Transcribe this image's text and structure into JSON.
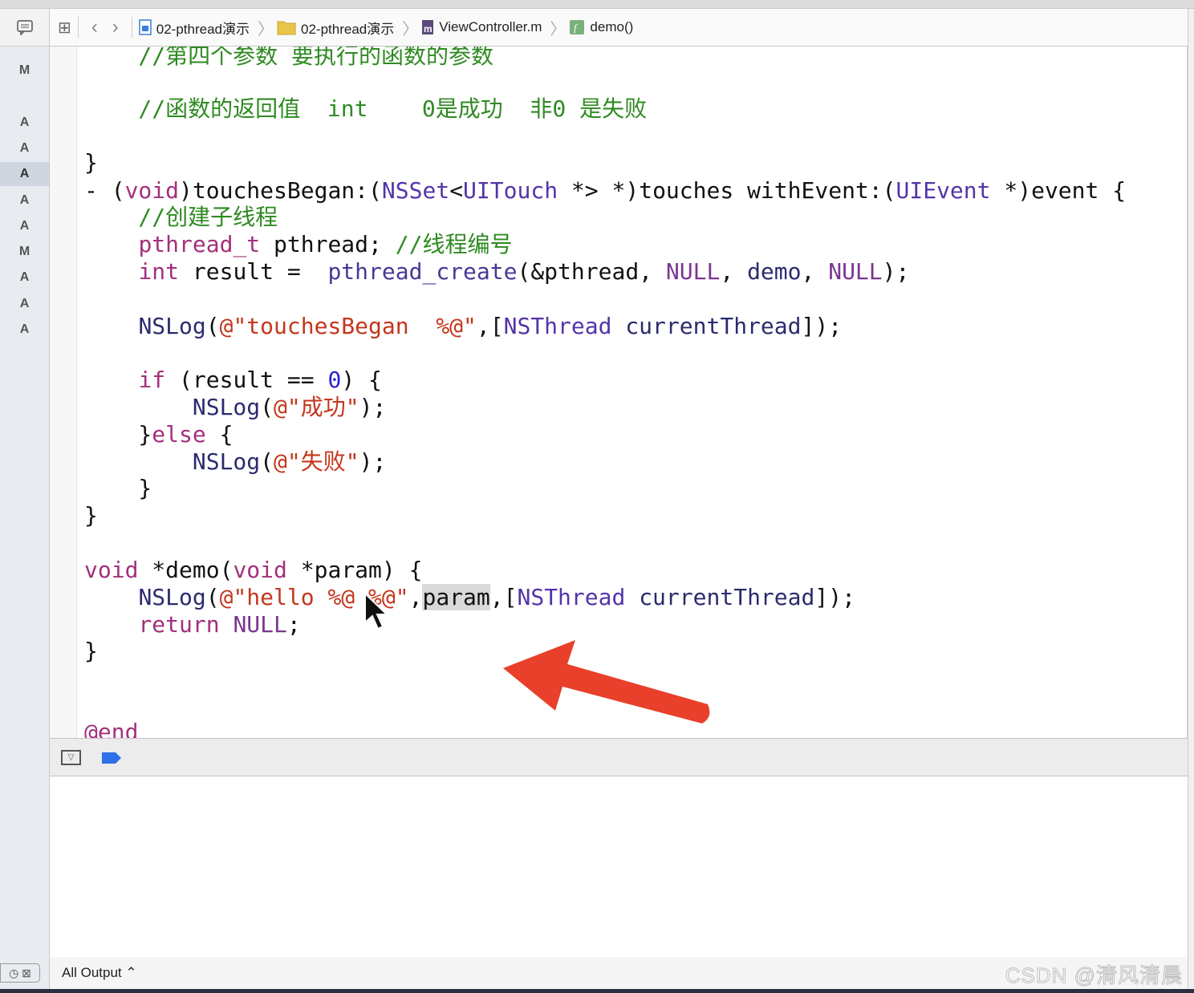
{
  "breadcrumb": [
    {
      "label": "02-pthread演示",
      "icon": "project-file-icon"
    },
    {
      "label": "02-pthread演示",
      "icon": "folder-icon"
    },
    {
      "label": "ViewController.m",
      "icon": "m-file-icon"
    },
    {
      "label": "demo()",
      "icon": "function-icon"
    }
  ],
  "sidebar": {
    "letters": [
      "M",
      "A",
      "A",
      "A",
      "A",
      "A",
      "M",
      "A",
      "A",
      "A"
    ],
    "selected_index": 4
  },
  "code": [
    [
      [
        "    //第四个参数 要执行的函数的参数",
        "cm"
      ]
    ],
    [
      [
        "    //函数的返回值  int    0是成功  非0 是失败",
        "cm"
      ]
    ],
    [
      [
        "}",
        ""
      ]
    ],
    [
      [
        "- (",
        ""
      ],
      [
        "void",
        "kw"
      ],
      [
        ")touchesBegan:(",
        ""
      ],
      [
        "NSSet",
        "ty"
      ],
      [
        "<",
        ""
      ],
      [
        "UITouch",
        "ty"
      ],
      [
        " *> *)touches withEvent:(",
        ""
      ],
      [
        "UIEvent",
        "ty"
      ],
      [
        " *)event {",
        ""
      ]
    ],
    [
      [
        "    //创建子线程",
        "cm"
      ]
    ],
    [
      [
        "    ",
        ""
      ],
      [
        "pthread_t",
        "kw"
      ],
      [
        " pthread; ",
        ""
      ],
      [
        "//线程编号",
        "cm"
      ]
    ],
    [
      [
        "    ",
        ""
      ],
      [
        "int",
        "kw"
      ],
      [
        " result =  ",
        ""
      ],
      [
        "pthread_create",
        "fn"
      ],
      [
        "(&pthread, ",
        ""
      ],
      [
        "NULL",
        "mc"
      ],
      [
        ", ",
        ""
      ],
      [
        "demo",
        "lg"
      ],
      [
        ", ",
        ""
      ],
      [
        "NULL",
        "mc"
      ],
      [
        ");",
        ""
      ]
    ],
    [
      [
        "",
        ""
      ]
    ],
    [
      [
        "    ",
        ""
      ],
      [
        "NSLog",
        "lg"
      ],
      [
        "(",
        ""
      ],
      [
        "@\"touchesBegan  %@\"",
        "st"
      ],
      [
        ",[",
        ""
      ],
      [
        "NSThread",
        "ty"
      ],
      [
        " ",
        ""
      ],
      [
        "currentThread",
        "lg"
      ],
      [
        "]);",
        ""
      ]
    ],
    [
      [
        "",
        ""
      ]
    ],
    [
      [
        "    ",
        ""
      ],
      [
        "if",
        "kw"
      ],
      [
        " (result == ",
        ""
      ],
      [
        "0",
        "nu"
      ],
      [
        ") {",
        ""
      ]
    ],
    [
      [
        "        ",
        ""
      ],
      [
        "NSLog",
        "lg"
      ],
      [
        "(",
        ""
      ],
      [
        "@\"成功\"",
        "st"
      ],
      [
        ");",
        ""
      ]
    ],
    [
      [
        "    }",
        ""
      ],
      [
        "else",
        "kw"
      ],
      [
        " {",
        ""
      ]
    ],
    [
      [
        "        ",
        ""
      ],
      [
        "NSLog",
        "lg"
      ],
      [
        "(",
        ""
      ],
      [
        "@\"失败\"",
        "st"
      ],
      [
        ");",
        ""
      ]
    ],
    [
      [
        "    }",
        ""
      ]
    ],
    [
      [
        "}",
        ""
      ]
    ],
    [
      [
        "",
        ""
      ]
    ],
    [
      [
        "void",
        "kw"
      ],
      [
        " *demo(",
        ""
      ],
      [
        "void",
        "kw"
      ],
      [
        " *param) {",
        ""
      ]
    ],
    [
      [
        "    ",
        ""
      ],
      [
        "NSLog",
        "lg"
      ],
      [
        "(",
        ""
      ],
      [
        "@\"hello %@ %@\"",
        "st"
      ],
      [
        ",",
        ""
      ],
      [
        "param",
        "hl"
      ],
      [
        ",[",
        ""
      ],
      [
        "NSThread",
        "ty"
      ],
      [
        " ",
        ""
      ],
      [
        "currentThread",
        "lg"
      ],
      [
        "]);",
        ""
      ]
    ],
    [
      [
        "    ",
        ""
      ],
      [
        "return",
        "kw"
      ],
      [
        " ",
        ""
      ],
      [
        "NULL",
        "mc"
      ],
      [
        ";",
        ""
      ]
    ],
    [
      [
        "}",
        ""
      ]
    ],
    [
      [
        "",
        ""
      ]
    ],
    [
      [
        "",
        ""
      ]
    ],
    [
      [
        "@end",
        "kw"
      ]
    ]
  ],
  "console": {
    "output_selector": "All Output ⌃"
  },
  "watermark": "CSDN @清风清晨",
  "colors": {
    "annotation_arrow": "#e8402a",
    "breakpoint_toggle": "#2f6fe8"
  }
}
